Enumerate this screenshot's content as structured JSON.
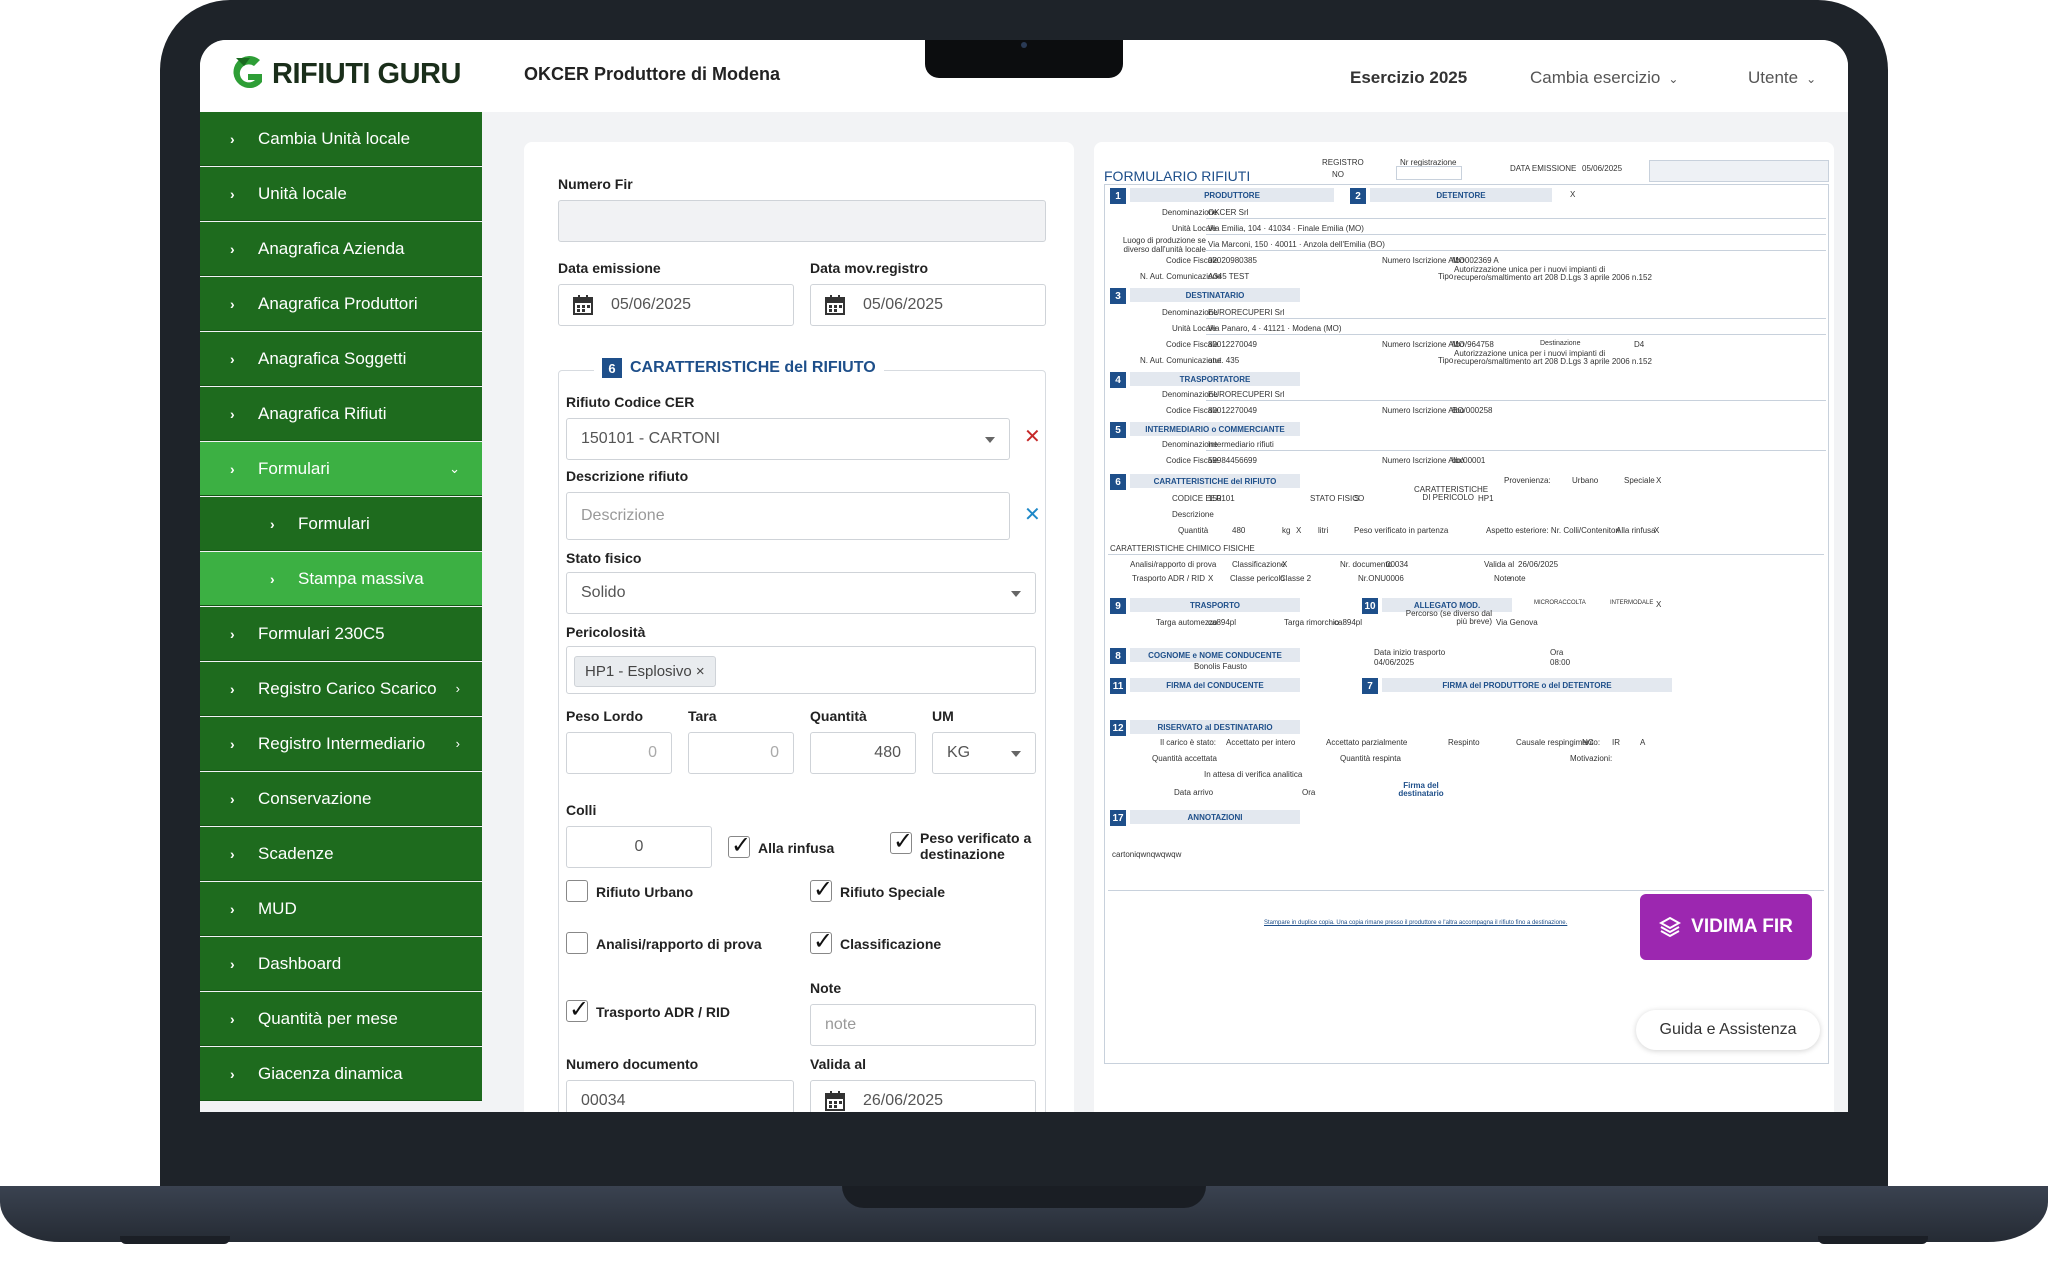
{
  "header": {
    "logo_text": "RIFIUTI GURU",
    "company": "OKCER Produttore di Modena",
    "esercizio": "Esercizio 2025",
    "cambia_esercizio": "Cambia esercizio",
    "utente": "Utente"
  },
  "sidebar": {
    "items": [
      {
        "label": "Cambia Unità locale"
      },
      {
        "label": "Unità locale"
      },
      {
        "label": "Anagrafica Azienda"
      },
      {
        "label": "Anagrafica Produttori"
      },
      {
        "label": "Anagrafica Soggetti"
      },
      {
        "label": "Anagrafica Rifiuti"
      },
      {
        "label": "Formulari"
      },
      {
        "label": "Formulari"
      },
      {
        "label": "Stampa massiva"
      },
      {
        "label": "Formulari 230C5"
      },
      {
        "label": "Registro Carico Scarico"
      },
      {
        "label": "Registro Intermediario"
      },
      {
        "label": "Conservazione"
      },
      {
        "label": "Scadenze"
      },
      {
        "label": "MUD"
      },
      {
        "label": "Dashboard"
      },
      {
        "label": "Quantità per mese"
      },
      {
        "label": "Giacenza dinamica"
      }
    ]
  },
  "form": {
    "numero_fir_label": "Numero Fir",
    "numero_fir_value": "",
    "data_emissione_label": "Data emissione",
    "data_emissione_value": "05/06/2025",
    "data_mov_label": "Data mov.registro",
    "data_mov_value": "05/06/2025",
    "section_num": "6",
    "section_title": "CARATTERISTICHE del RIFIUTO",
    "cer_label": "Rifiuto Codice CER",
    "cer_value": "150101 - CARTONI",
    "descrizione_label": "Descrizione rifiuto",
    "descrizione_placeholder": "Descrizione",
    "stato_label": "Stato fisico",
    "stato_value": "Solido",
    "pericolosita_label": "Pericolosità",
    "pericolosita_chip": "HP1 - Esplosivo ×",
    "peso_lordo_label": "Peso Lordo",
    "peso_lordo_value": "0",
    "tara_label": "Tara",
    "tara_value": "0",
    "quantita_label": "Quantità",
    "quantita_value": "480",
    "um_label": "UM",
    "um_value": "KG",
    "colli_label": "Colli",
    "colli_value": "0",
    "alla_rinfusa": "Alla rinfusa",
    "peso_verificato_1": "Peso verificato a",
    "peso_verificato_2": "destinazione",
    "rifiuto_urbano": "Rifiuto Urbano",
    "rifiuto_speciale": "Rifiuto Speciale",
    "analisi": "Analisi/rapporto di prova",
    "classificazione": "Classificazione",
    "note_label": "Note",
    "note_placeholder": "note",
    "trasporto_adr": "Trasporto ADR / RID",
    "numero_documento_label": "Numero documento",
    "numero_documento_value": "00034",
    "valida_al_label": "Valida al",
    "valida_al_value": "26/06/2025"
  },
  "preview": {
    "title": "FORMULARIO RIFIUTI",
    "registro": "REGISTRO",
    "no": "NO",
    "nr_registrazione": "Nr registrazione",
    "data_emissione": "DATA EMISSIONE",
    "data_value": "05/06/2025",
    "produttore": "PRODUTTORE",
    "detentore": "DETENTORE",
    "x": "X",
    "denominazione": "Denominazione",
    "prod_denominazione": "OKCER Srl",
    "unita_locale": "Unità Locale",
    "prod_unita": "Via Emilia, 104 · 41034 · Finale Emilia (MO)",
    "luogo_produzione": "Luogo di produzione se diverso dall'unità locale",
    "prod_luogo": "Via Marconi, 150 · 40011 · Anzola dell'Emilia (BO)",
    "codice_fiscale": "Codice Fiscale",
    "prod_cf": "02020980385",
    "numero_albo": "Numero Iscrizione Albo",
    "prod_albo": "MO002369 A",
    "aut_comunicazione": "N. Aut. Comunicazione",
    "prod_aut": "A345 TEST",
    "tipo": "Tipo",
    "autorizzazione_text": "Autorizzazione unica per i nuovi impianti di recupero/smaltimento art 208 D.Lgs 3 aprile 2006 n.152",
    "destinatario": "DESTINATARIO",
    "dest_denominazione": "EURORECUPERI Srl",
    "dest_unita": "Via Panaro, 4 · 41121 · Modena (MO)",
    "dest_cf": "80012270049",
    "dest_albo": "MO/964758",
    "destinazione": "Destinazione",
    "dest_code": "D4",
    "dest_aut": "atut. 435",
    "trasportatore": "TRASPORTATORE",
    "trasp_denominazione": "EURORECUPERI Srl",
    "trasp_cf": "80012270049",
    "trasp_albo": "BO/000258",
    "intermediario": "INTERMEDIARIO o COMMERCIANTE",
    "int_denominazione": "Intermediario rifiuti",
    "int_cf": "59984456699",
    "int_albo": "bo/00001",
    "caratteristiche": "CARATTERISTICHE del RIFIUTO",
    "provenienza": "Provenienza:",
    "urbano": "Urbano",
    "speciale": "Speciale",
    "codice_eer": "CODICE EER",
    "eer_value": "150101",
    "stato_fisico": "STATO FISICO",
    "stato_value": "S",
    "caratt_pericolo": "CARATTERISTICHE DI PERICOLO",
    "hp_value": "HP1",
    "descrizione": "Descrizione",
    "quantita": "Quantità",
    "qta_value": "480",
    "kg": "kg",
    "litri": "litri",
    "peso_verificato": "Peso verificato in partenza",
    "aspetto": "Aspetto esteriore: Nr. Colli/Contenitori",
    "alla_rinfusa": "Alla rinfusa",
    "chimico_fisiche": "CARATTERISTICHE CHIMICO FISICHE",
    "analisi": "Analisi/rapporto di prova",
    "classificazione": "Classificazione",
    "nr_documento": "Nr. documento",
    "doc_value": "00034",
    "valida_al": "Valida al",
    "valida_value": "26/06/2025",
    "trasporto_adr": "Trasporto ADR / RID",
    "classe_pericolo": "Classe pericolo",
    "classe_value": "Classe 2",
    "nr_onu": "Nr.ONU",
    "onu_value": "0006",
    "note": "Note",
    "note_value": "note",
    "trasporto": "TRASPORTO",
    "allegato": "ALLEGATO MOD.",
    "microraccolta": "MICRORACCOLTA",
    "intermodale": "INTERMODALE",
    "targa_automezzo": "Targa automezzo",
    "targa_value": "ca894pl",
    "targa_rimorchio": "Targa rimorchio",
    "rimorchio_value": "ca894pl",
    "percorso": "Percorso (se diverso dal più breve)",
    "percorso_value": "Via Genova",
    "conducente": "COGNOME e NOME CONDUCENTE",
    "conducente_value": "Bonolis Fausto",
    "data_inizio": "Data inizio trasporto",
    "data_inizio_value": "04/06/2025",
    "ora": "Ora",
    "ora_value": "08:00",
    "firma_conducente": "FIRMA del CONDUCENTE",
    "firma_produttore": "FIRMA del PRODUTTORE o del DETENTORE",
    "riservato": "RISERVATO al DESTINATARIO",
    "carico_stato": "Il carico è stato:",
    "accettato_intero": "Accettato per intero",
    "accettato_parz": "Accettato parzialmente",
    "respinto": "Respinto",
    "causale": "Causale respingimento:",
    "nc": "NC",
    "ir": "IR",
    "a": "A",
    "qta_accettata": "Quantità accettata",
    "qta_respinta": "Quantità respinta",
    "motivazioni": "Motivazioni:",
    "attesa_verifica": "In attesa di verifica analitica",
    "data_arrivo": "Data arrivo",
    "firma_destinatario": "Firma del destinatario",
    "annotazioni": "ANNOTAZIONI",
    "annotazioni_value": "cartoniqwnqwqwqw",
    "footer_link": "Stampare in duplice copia. Una copia rimane presso il produttore e l'altra accompagna il rifiuto fino a destinazione."
  },
  "buttons": {
    "vidima_fir": "VIDIMA FIR",
    "guida": "Guida e Assistenza"
  },
  "colors": {
    "sidebar_green": "#1e6b1e",
    "active_green": "#3cb043",
    "doc_blue": "#1e4f8a",
    "vidima_purple": "#9c27b0",
    "error_red": "#c62828"
  }
}
